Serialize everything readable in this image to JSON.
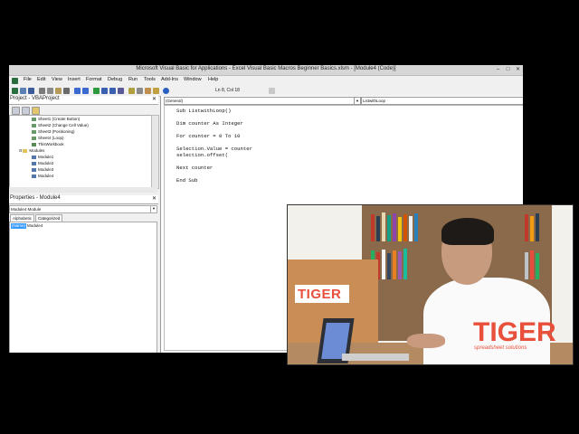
{
  "window": {
    "title": "Microsoft Visual Basic for Applications - Excel Visual Basic Macros Beginner Basics.xlsm - [Module4 (Code)]",
    "min_glyph": "–",
    "max_glyph": "□",
    "close_glyph": "✕"
  },
  "menu": [
    "File",
    "Edit",
    "View",
    "Insert",
    "Format",
    "Debug",
    "Run",
    "Tools",
    "Add-Ins",
    "Window",
    "Help"
  ],
  "toolbar": {
    "cursor_position": "Ln 8, Col 18"
  },
  "project": {
    "title": "Project - VBAProject",
    "items": [
      {
        "label": "Sheet1 (Create Button)",
        "indent": 2
      },
      {
        "label": "Sheet2 (Change Cell Value)",
        "indent": 2
      },
      {
        "label": "Sheet3 (Positioning)",
        "indent": 2
      },
      {
        "label": "Sheet4 (Loop)",
        "indent": 2
      },
      {
        "label": "ThisWorkbook",
        "indent": 2
      },
      {
        "label": "Modules",
        "indent": 1
      },
      {
        "label": "Module1",
        "indent": 2
      },
      {
        "label": "Module2",
        "indent": 2
      },
      {
        "label": "Module3",
        "indent": 2
      },
      {
        "label": "Module4",
        "indent": 2
      }
    ]
  },
  "properties": {
    "title": "Properties - Module4",
    "object": "Module4  Module",
    "tabs": [
      "Alphabetic",
      "Categorized"
    ],
    "name_key": "(Name)",
    "name_value": "Module4"
  },
  "code": {
    "object_dropdown": "(General)",
    "procedure_dropdown": "ListwithLoop",
    "lines": [
      "Sub ListwithLoop()",
      "",
      "Dim counter As Integer",
      "",
      "For counter = 0 To 10",
      "",
      "Selection.Value = counter",
      "selection.offset(",
      "",
      "Next counter",
      "",
      "End Sub"
    ]
  },
  "video": {
    "box_logo": "TIGER",
    "watermark": "TIGER",
    "watermark_sub": "spreadsheet solutions"
  },
  "colors": {
    "accent": "#e8503c",
    "selection": "#3399ff"
  }
}
